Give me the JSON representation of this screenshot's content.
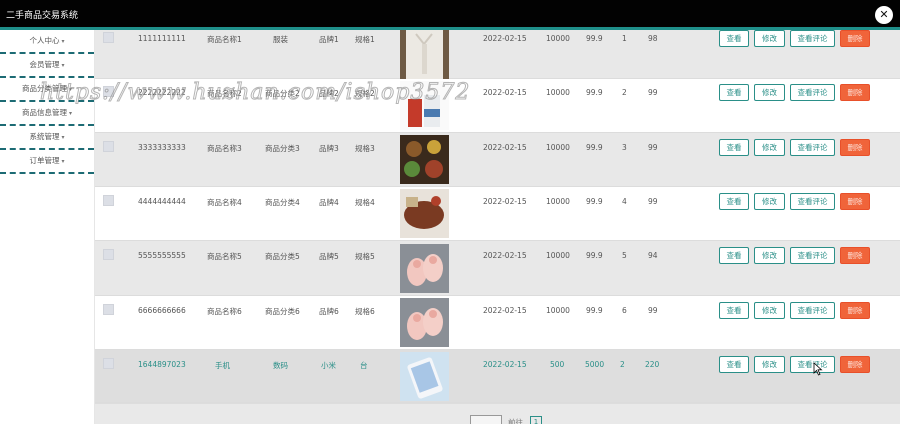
{
  "app": {
    "title": "二手商品交易系统",
    "close_icon": "close-icon"
  },
  "sidebar": {
    "items": [
      {
        "label": "个人中心"
      },
      {
        "label": "会员管理"
      },
      {
        "label": "商品分类管理"
      },
      {
        "label": "商品信息管理"
      },
      {
        "label": "系统管理"
      },
      {
        "label": "订单管理"
      }
    ]
  },
  "table": {
    "rows": [
      {
        "code": "1111111111",
        "name": "商品名称1",
        "category": "服装",
        "brand": "品牌1",
        "spec": "规格1",
        "date": "2022-02-15",
        "stock": "10000",
        "price": "99.9",
        "n1": "1",
        "n2": "98",
        "image": "white-blouse"
      },
      {
        "code": "2222222222",
        "name": "商品名称2",
        "category": "商品分类2",
        "brand": "品牌2",
        "spec": "规格2",
        "date": "2022-02-15",
        "stock": "10000",
        "price": "99.9",
        "n1": "2",
        "n2": "99",
        "image": "drink-bottles"
      },
      {
        "code": "3333333333",
        "name": "商品名称3",
        "category": "商品分类3",
        "brand": "品牌3",
        "spec": "规格3",
        "date": "2022-02-15",
        "stock": "10000",
        "price": "99.9",
        "n1": "3",
        "n2": "99",
        "image": "food-platter"
      },
      {
        "code": "4444444444",
        "name": "商品名称4",
        "category": "商品分类4",
        "brand": "品牌4",
        "spec": "规格4",
        "date": "2022-02-15",
        "stock": "10000",
        "price": "99.9",
        "n1": "4",
        "n2": "99",
        "image": "grilled-food"
      },
      {
        "code": "5555555555",
        "name": "商品名称5",
        "category": "商品分类5",
        "brand": "品牌5",
        "spec": "规格5",
        "date": "2022-02-15",
        "stock": "10000",
        "price": "99.9",
        "n1": "5",
        "n2": "94",
        "image": "pink-shoes"
      },
      {
        "code": "6666666666",
        "name": "商品名称6",
        "category": "商品分类6",
        "brand": "品牌6",
        "spec": "规格6",
        "date": "2022-02-15",
        "stock": "10000",
        "price": "99.9",
        "n1": "6",
        "n2": "99",
        "image": "pink-shoes"
      },
      {
        "code": "1644897023",
        "name": "手机",
        "category": "数码",
        "brand": "小米",
        "spec": "台",
        "date": "2022-02-15",
        "stock": "500",
        "price": "5000",
        "n1": "2",
        "n2": "220",
        "image": "phone"
      }
    ],
    "actions": {
      "view": "查看",
      "edit": "修改",
      "reviews": "查看评论",
      "delete": "删除"
    }
  },
  "pagination": {
    "goto_label": "前往",
    "page": "1"
  },
  "watermark": "https://www.huzhan.com/ishop3572",
  "colors": {
    "accent": "#1f8f8a",
    "delete": "#f0643a",
    "topbar": "#020202"
  }
}
